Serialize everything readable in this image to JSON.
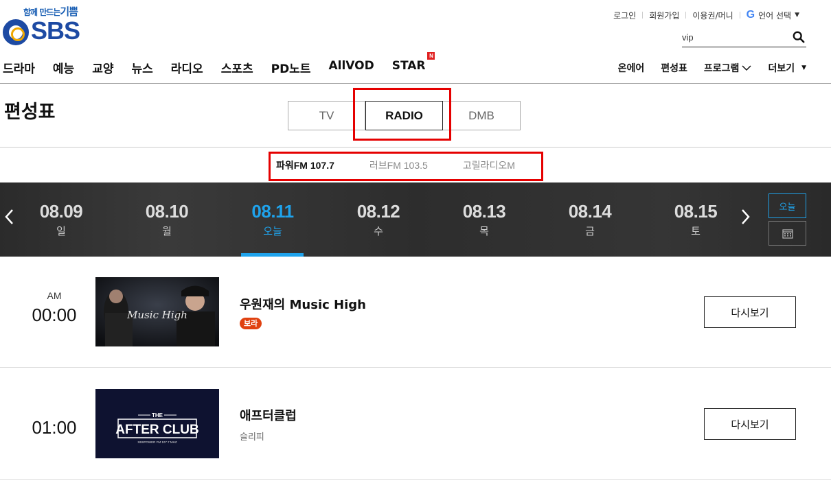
{
  "header": {
    "logo_slogan_small": "함께 만드는",
    "logo_slogan_big": "기쁨",
    "logo_word": "SBS",
    "util_links": [
      "로그인",
      "회원가입",
      "이용권/머니"
    ],
    "lang_label": "언어 선택",
    "search_value": "vip"
  },
  "gnb": {
    "items": [
      "드라마",
      "예능",
      "교양",
      "뉴스",
      "라디오",
      "스포츠",
      "PD노트",
      "AllVOD",
      "STAR"
    ],
    "star_badge": "N",
    "right_items": [
      "온에어",
      "편성표",
      "프로그램",
      "더보기"
    ]
  },
  "page": {
    "title": "편성표",
    "media_tabs": [
      "TV",
      "RADIO",
      "DMB"
    ],
    "active_media_tab": "RADIO",
    "channels": [
      "파워FM 107.7",
      "러브FM 103.5",
      "고릴라디오M"
    ],
    "active_channel": "파워FM 107.7"
  },
  "datebar": {
    "days": [
      {
        "date": "08.09",
        "weekday": "일"
      },
      {
        "date": "08.10",
        "weekday": "월"
      },
      {
        "date": "08.11",
        "weekday": "오늘"
      },
      {
        "date": "08.12",
        "weekday": "수"
      },
      {
        "date": "08.13",
        "weekday": "목"
      },
      {
        "date": "08.14",
        "weekday": "금"
      },
      {
        "date": "08.15",
        "weekday": "토"
      }
    ],
    "active_index": 2,
    "today_label": "오늘",
    "accent": "#1fa3ec"
  },
  "schedule": [
    {
      "ampm": "AM",
      "time": "00:00",
      "title": "우원재의 Music High",
      "badge": "보라",
      "thumb_text": "Music High",
      "replay": "다시보기"
    },
    {
      "ampm": "",
      "time": "01:00",
      "title": "애프터클럽",
      "sub": "슬리피",
      "thumb_text": "AFTER CLUB",
      "thumb_top": "THE",
      "thumb_bottom": "SBSPOWER FM 107.7 MHZ",
      "replay": "다시보기"
    }
  ]
}
